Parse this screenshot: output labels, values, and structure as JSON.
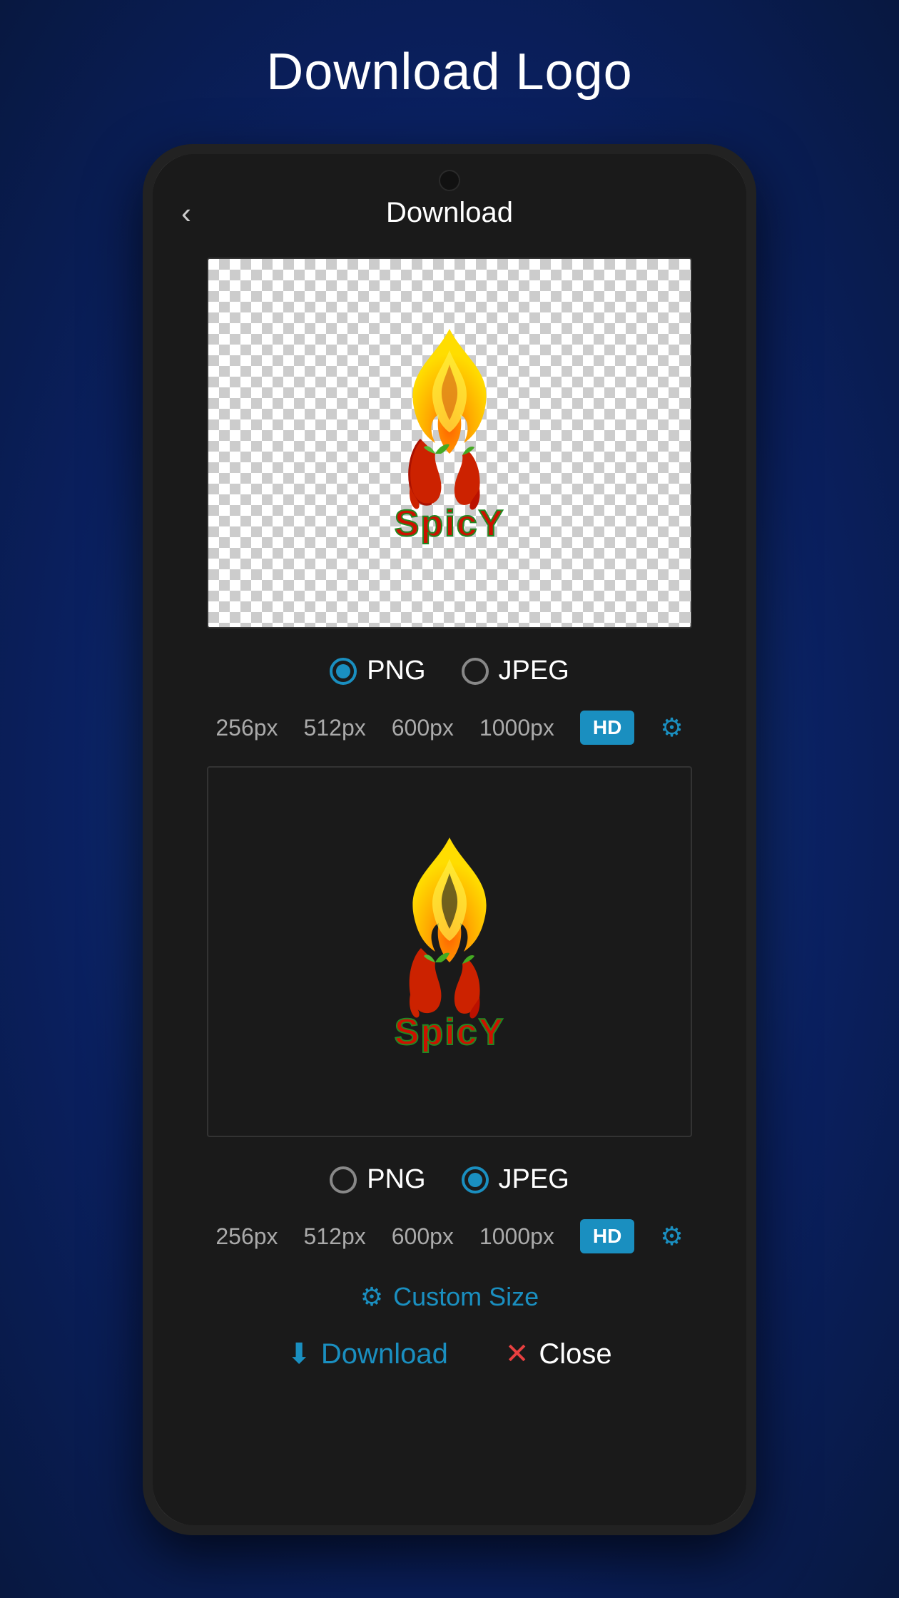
{
  "page": {
    "title": "Download Logo",
    "screen": {
      "topBar": {
        "backLabel": "‹",
        "title": "Download"
      },
      "logoSection1": {
        "background": "transparent",
        "format": {
          "options": [
            "PNG",
            "JPEG"
          ],
          "selected": "PNG"
        },
        "sizes": [
          "256px",
          "512px",
          "600px",
          "1000px"
        ],
        "hdLabel": "HD"
      },
      "logoSection2": {
        "background": "dark",
        "format": {
          "options": [
            "PNG",
            "JPEG"
          ],
          "selected": "JPEG"
        },
        "sizes": [
          "256px",
          "512px",
          "600px",
          "1000px"
        ],
        "hdLabel": "HD"
      },
      "customSize": {
        "label": "Custom Size"
      },
      "actions": {
        "download": "Download",
        "close": "Close"
      }
    }
  }
}
